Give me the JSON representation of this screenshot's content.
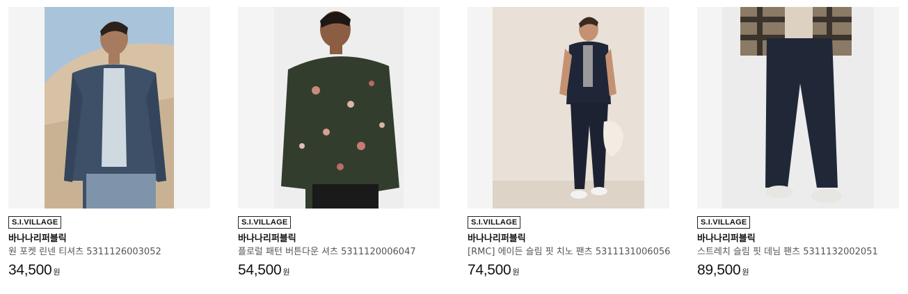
{
  "products": [
    {
      "badge": "S.I.VILLAGE",
      "brand": "바나나리퍼블릭",
      "name": "원 포켓 린넨 티셔츠 5311126003052",
      "price": "34,500",
      "currency": "원",
      "image": "model-navy-linen-shirt-photo"
    },
    {
      "badge": "S.I.VILLAGE",
      "brand": "바나나리퍼블릭",
      "name": "플로럴 패턴 버튼다운 셔츠 5311120006047",
      "price": "54,500",
      "currency": "원",
      "image": "model-floral-shirt-photo"
    },
    {
      "badge": "S.I.VILLAGE",
      "brand": "바나나리퍼블릭",
      "name": "[RMC] 에이든 슬림 핏 치노 팬츠 5311131006056",
      "price": "74,500",
      "currency": "원",
      "image": "model-chino-pants-photo"
    },
    {
      "badge": "S.I.VILLAGE",
      "brand": "바나나리퍼블릭",
      "name": "스트레치 슬림 핏 데님 팬츠 5311132002051",
      "price": "89,500",
      "currency": "원",
      "image": "model-denim-pants-photo"
    }
  ]
}
